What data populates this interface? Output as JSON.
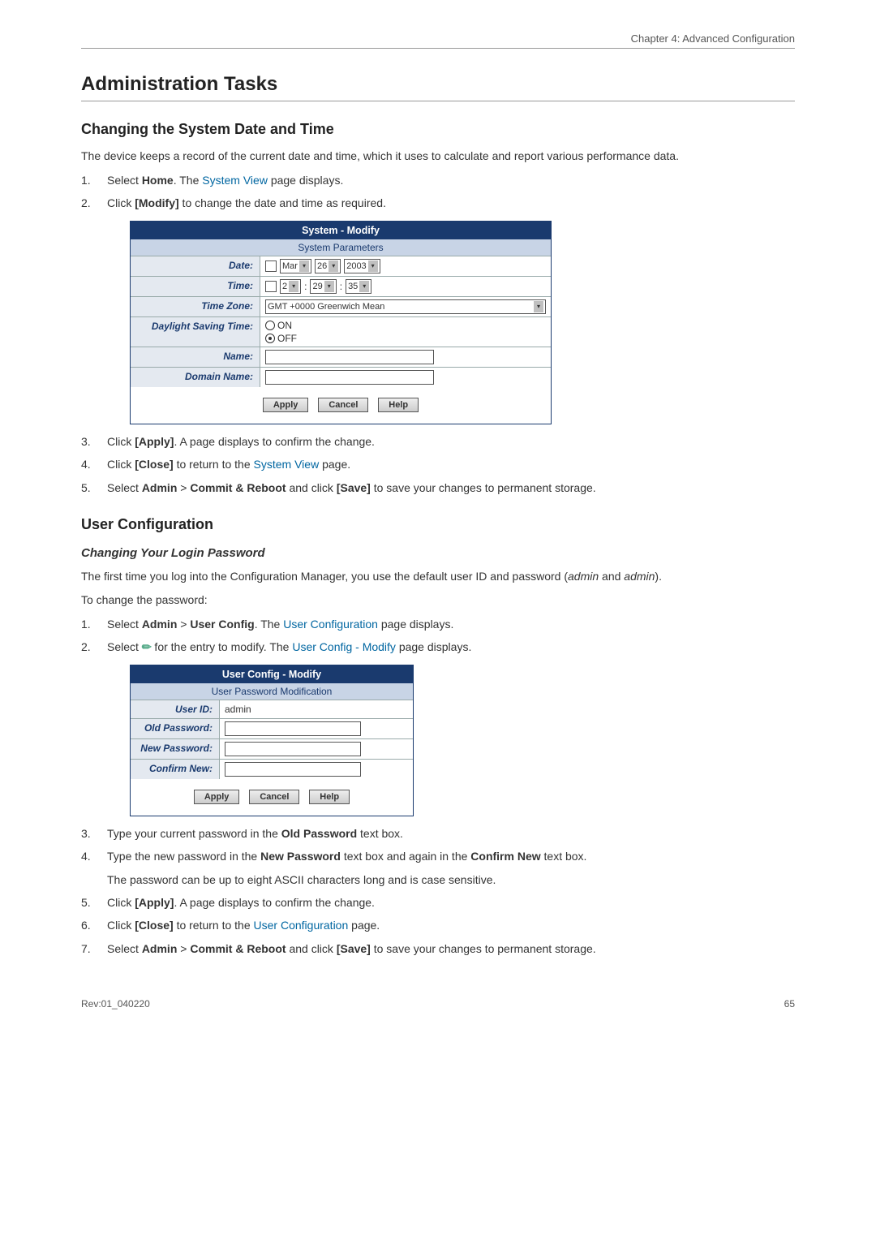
{
  "header": {
    "chapter": "Chapter 4: Advanced Configuration"
  },
  "h1": "Administration Tasks",
  "sec1": {
    "title": "Changing the System Date and Time",
    "intro": "The device keeps a record of the current date and time, which it uses to calculate and report various performance data.",
    "step1_pre": "Select ",
    "step1_bold": "Home",
    "step1_mid": ". The ",
    "step1_link": "System View",
    "step1_post": " page displays.",
    "step2_pre": "Click ",
    "step2_bold": "[Modify]",
    "step2_post": " to change the date and time as required.",
    "step3_pre": "Click ",
    "step3_bold": "[Apply]",
    "step3_post": ". A page displays to confirm the change.",
    "step4_pre": "Click ",
    "step4_bold": "[Close]",
    "step4_mid": " to return to the ",
    "step4_link": "System View",
    "step4_post": " page.",
    "step5_pre": "Select ",
    "step5_b1": "Admin",
    "step5_gt": " > ",
    "step5_b2": "Commit & Reboot",
    "step5_mid": " and click ",
    "step5_b3": "[Save]",
    "step5_post": " to save your changes to permanent storage."
  },
  "sysPanel": {
    "title": "System - Modify",
    "subtitle": "System Parameters",
    "labels": {
      "date": "Date:",
      "time": "Time:",
      "tz": "Time Zone:",
      "dst": "Daylight Saving Time:",
      "name": "Name:",
      "domain": "Domain Name:"
    },
    "date": {
      "month": "Mar",
      "day": "26",
      "year": "2003"
    },
    "time": {
      "h": "2",
      "m": "29",
      "s": "35"
    },
    "tz": "GMT +0000 Greenwich Mean",
    "dst": {
      "on": "ON",
      "off": "OFF"
    },
    "buttons": {
      "apply": "Apply",
      "cancel": "Cancel",
      "help": "Help"
    }
  },
  "sec2": {
    "title": "User Configuration",
    "sub": "Changing Your Login Password",
    "intro_pre": "The first time you log into the Configuration Manager, you use the default user ID and password (",
    "intro_i1": "admin",
    "intro_mid": " and ",
    "intro_i2": "admin",
    "intro_post": ").",
    "toChange": "To change the password:",
    "step1_pre": "Select ",
    "step1_b1": "Admin",
    "step1_gt": " > ",
    "step1_b2": "User Config",
    "step1_mid": ". The ",
    "step1_link": "User Configuration",
    "step1_post": " page displays.",
    "step2_pre": "Select ",
    "step2_mid": " for the entry to modify. The ",
    "step2_link": "User Config - Modify",
    "step2_post": " page displays."
  },
  "userPanel": {
    "title": "User Config - Modify",
    "subtitle": "User Password Modification",
    "labels": {
      "uid": "User ID:",
      "old": "Old Password:",
      "new": "New Password:",
      "conf": "Confirm New:"
    },
    "userId": "admin",
    "buttons": {
      "apply": "Apply",
      "cancel": "Cancel",
      "help": "Help"
    }
  },
  "sec3": {
    "step3_pre": "Type your current password in the ",
    "step3_b": "Old Password",
    "step3_post": " text box.",
    "step4_pre": "Type the new password in the ",
    "step4_b1": "New Password",
    "step4_mid": " text box and again in the ",
    "step4_b2": "Confirm New",
    "step4_post": " text box.",
    "step4_line2": "The password can be up to eight ASCII characters long and is case sensitive.",
    "step5_pre": "Click ",
    "step5_b": "[Apply]",
    "step5_post": ". A page displays to confirm the change.",
    "step6_pre": "Click ",
    "step6_b": "[Close]",
    "step6_mid": " to return to the ",
    "step6_link": "User Configuration",
    "step6_post": " page.",
    "step7_pre": "Select ",
    "step7_b1": "Admin",
    "step7_gt": " > ",
    "step7_b2": "Commit & Reboot",
    "step7_mid": " and click ",
    "step7_b3": "[Save]",
    "step7_post": " to save your changes to permanent storage."
  },
  "footer": {
    "rev": "Rev:01_040220",
    "page": "65"
  }
}
